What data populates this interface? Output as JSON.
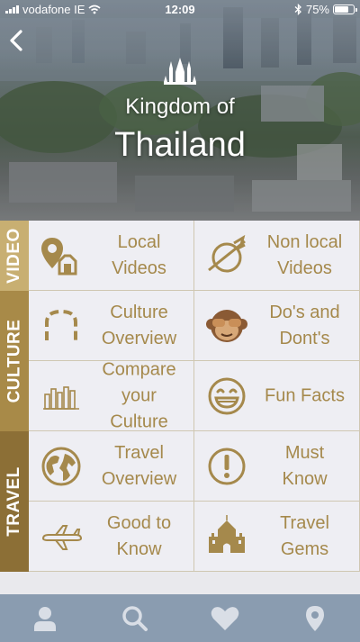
{
  "status_bar": {
    "carrier": "vodafone IE",
    "time": "12:09",
    "battery": "75%",
    "battery_level": 0.75
  },
  "header": {
    "subtitle": "Kingdom of",
    "title": "Thailand"
  },
  "sections": [
    {
      "label": "VIDEO",
      "color": "#c8af72"
    },
    {
      "label": "CULTURE",
      "color": "#a88a48"
    },
    {
      "label": "TRAVEL",
      "color": "#8c6f36"
    }
  ],
  "tiles": [
    {
      "label": "Local Videos",
      "icon": "map-pin-icon"
    },
    {
      "label": "Non local Videos",
      "icon": "planet-plane-icon"
    },
    {
      "label": "Culture Overview",
      "icon": "arch-icon"
    },
    {
      "label": "Do's and Dont's",
      "icon": "see-no-evil-monkey-icon"
    },
    {
      "label": "Compare your Culture",
      "icon": "bar-chart-icon"
    },
    {
      "label": "Fun Facts",
      "icon": "grinning-face-icon"
    },
    {
      "label": "Travel Overview",
      "icon": "globe-icon"
    },
    {
      "label": "Must Know",
      "icon": "exclamation-icon"
    },
    {
      "label": "Good to Know",
      "icon": "airplane-icon"
    },
    {
      "label": "Travel Gems",
      "icon": "castle-icon"
    }
  ],
  "tab_bar": [
    "person-icon",
    "search-icon",
    "heart-icon",
    "location-pin-icon"
  ],
  "colors": {
    "gold": "#a5894c",
    "tile_bg": "#eeeef3",
    "tab_bar": "#8a9cb0"
  }
}
